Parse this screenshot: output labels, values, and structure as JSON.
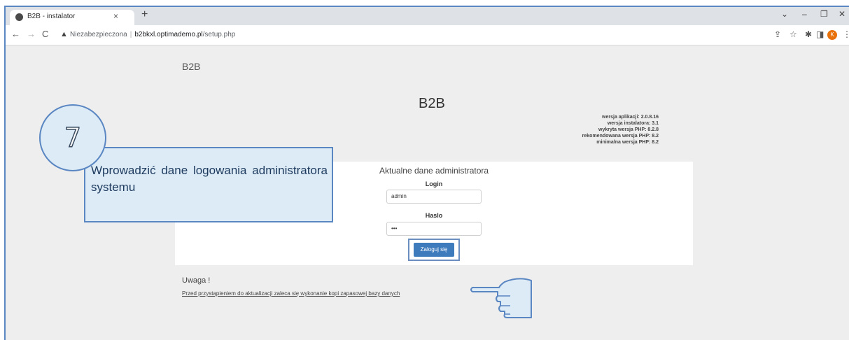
{
  "browser": {
    "tab_title": "B2B - instalator",
    "tab_close": "×",
    "new_tab": "+",
    "security_label": "Niezabezpieczona",
    "url_host": "b2bkxl.optimademo.pl",
    "url_path": "/setup.php",
    "profile_initial": "K"
  },
  "page": {
    "header_small": "B2B",
    "header_title": "B2B",
    "versions": {
      "app": "wersja aplikacji: 2.0.8.16",
      "installer": "wersja instalatora: 3.1",
      "php_detected": "wykryta wersja PHP: 8.2.8",
      "php_recommended": "rekomendowana wersja PHP: 8.2",
      "php_minimum": "minimalna wersja PHP: 8.2"
    },
    "form": {
      "title": "Aktualne dane administratora",
      "login_label": "Login",
      "login_value": "admin",
      "password_label": "Haslo",
      "password_value": "•••",
      "submit_label": "Zaloguj się"
    },
    "notice_title": "Uwaga !",
    "notice_text": "Przed przystąpieniem do aktualizacji zaleca się wykonanie kopi zapasowej bazy danych"
  },
  "overlay": {
    "step_number": "7",
    "step_text": "Wprowadzić dane logowania administratora systemu"
  },
  "colors": {
    "callout_fill": "#dcebf6",
    "callout_border": "#5a86c2",
    "button": "#3e7bbd"
  }
}
